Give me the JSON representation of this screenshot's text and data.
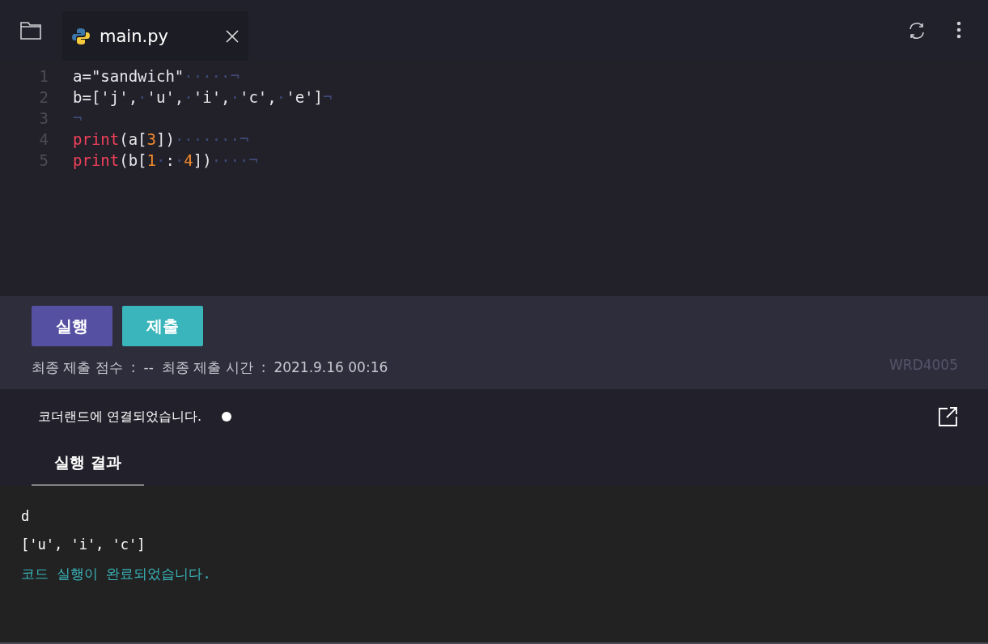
{
  "editor_tabs": [
    {
      "label": "main.py",
      "selected": true
    }
  ],
  "code_lines": [
    {
      "number": "1",
      "tokens": [
        {
          "kind": "plain",
          "text": "a=\"sandwich\""
        },
        {
          "kind": "invisible",
          "text": "·····¬"
        }
      ]
    },
    {
      "number": "2",
      "tokens": [
        {
          "kind": "plain",
          "text": "b=['j',"
        },
        {
          "kind": "invisible",
          "text": "·"
        },
        {
          "kind": "plain",
          "text": "'u',"
        },
        {
          "kind": "invisible",
          "text": "·"
        },
        {
          "kind": "plain",
          "text": "'i',"
        },
        {
          "kind": "invisible",
          "text": "·"
        },
        {
          "kind": "plain",
          "text": "'c',"
        },
        {
          "kind": "invisible",
          "text": "·"
        },
        {
          "kind": "plain",
          "text": "'e']"
        },
        {
          "kind": "invisible",
          "text": "¬"
        }
      ]
    },
    {
      "number": "3",
      "tokens": [
        {
          "kind": "invisible",
          "text": "¬"
        }
      ]
    },
    {
      "number": "4",
      "tokens": [
        {
          "kind": "keyword",
          "text": "print"
        },
        {
          "kind": "plain",
          "text": "(a["
        },
        {
          "kind": "number",
          "text": "3"
        },
        {
          "kind": "plain",
          "text": "])"
        },
        {
          "kind": "invisible",
          "text": "·······¬"
        }
      ]
    },
    {
      "number": "5",
      "tokens": [
        {
          "kind": "keyword",
          "text": "print"
        },
        {
          "kind": "plain",
          "text": "(b["
        },
        {
          "kind": "number",
          "text": "1"
        },
        {
          "kind": "invisible",
          "text": "·"
        },
        {
          "kind": "plain",
          "text": ":"
        },
        {
          "kind": "invisible",
          "text": "·"
        },
        {
          "kind": "number",
          "text": "4"
        },
        {
          "kind": "plain",
          "text": "])"
        },
        {
          "kind": "invisible",
          "text": "····¬"
        }
      ]
    }
  ],
  "actions": [
    {
      "label": "실행",
      "kind": "run"
    },
    {
      "label": "제출",
      "kind": "submit"
    }
  ],
  "submission_info": [
    {
      "label": "최종 제출 점수",
      "separator": ":",
      "value": "--"
    },
    {
      "label": "최종 제출 시간",
      "separator": ":",
      "value": "2021.9.16 00:16"
    }
  ],
  "problem_code": "WRD4005",
  "connection_status": "코더랜드에 연결되었습니다.",
  "output_tabs": [
    {
      "label": "실행 결과",
      "selected": true
    }
  ],
  "output_lines": [
    {
      "kind": "stdout",
      "text": "d"
    },
    {
      "kind": "stdout",
      "text": "['u', 'i', 'c']"
    },
    {
      "kind": "info",
      "text": "코드 실행이 완료되었습니다."
    }
  ]
}
